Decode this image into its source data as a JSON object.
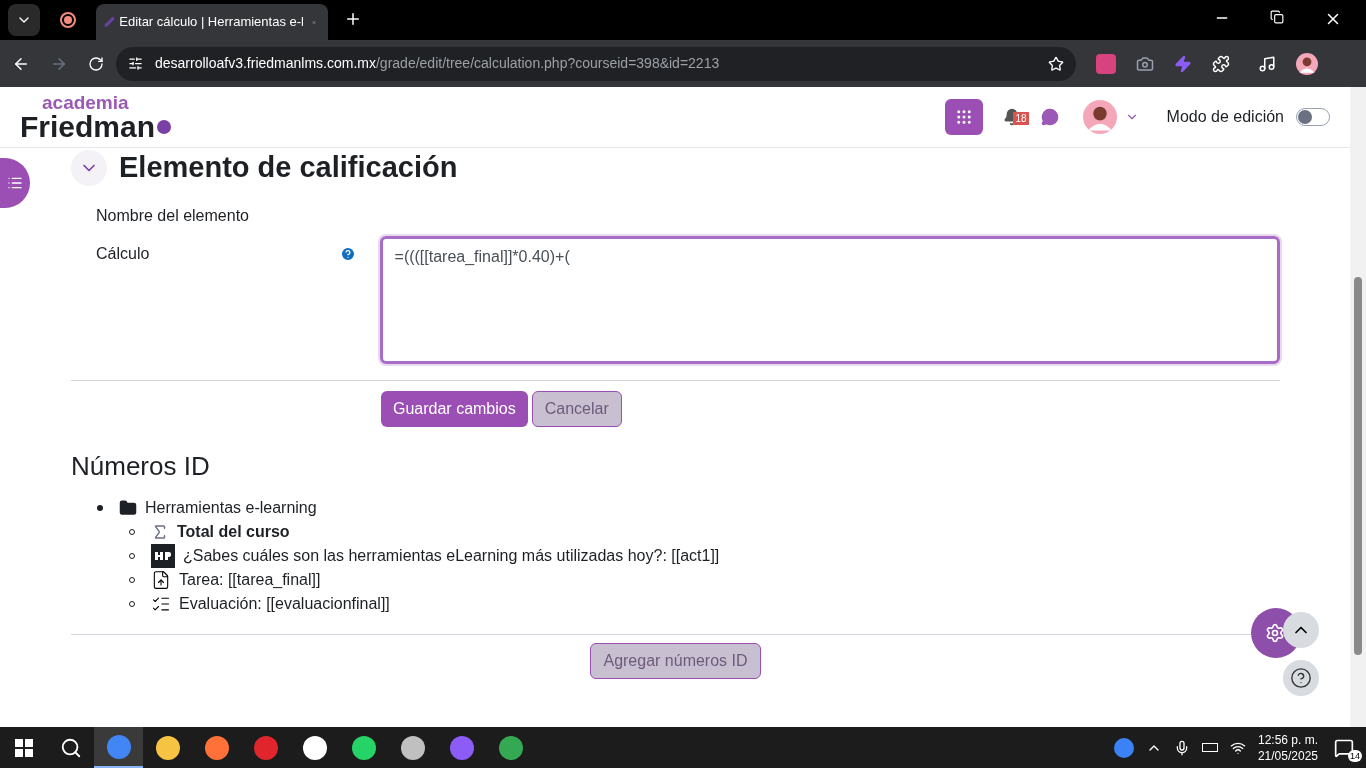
{
  "browser": {
    "tab_title": "Editar cálculo | Herramientas e-l",
    "url_host": "desarrolloafv3.friedmanlms.com.mx",
    "url_path": "/grade/edit/tree/calculation.php?courseid=398&id=2213"
  },
  "header": {
    "logo_top": "academia",
    "logo_main": "Friedman",
    "notification_count": "18",
    "edit_mode": {
      "label": "Modo de edición",
      "on": false
    }
  },
  "section": {
    "title": "Elemento de calificación",
    "expanded": true,
    "fields": [
      {
        "label": "Nombre del elemento",
        "kind": "empty"
      },
      {
        "label": "Cálculo",
        "kind": "textarea",
        "value": "=((([[tarea_final]]*0.40)+("
      }
    ]
  },
  "buttons": [
    {
      "label": "Guardar cambios",
      "kind": "primary"
    },
    {
      "label": "Cancelar",
      "kind": "secondary"
    }
  ],
  "ids": {
    "title": "Números ID",
    "items": [
      {
        "text": "Herramientas e-learning",
        "kind": "folder",
        "children": [
          {
            "text": "Total del curso",
            "kind": "total"
          },
          {
            "text": "¿Sabes cuáles son las herramientas eLearning más utilizadas hoy?: [[act1]]",
            "kind": "h5p"
          },
          {
            "text": "Tarea: [[tarea_final]]",
            "kind": "assignment"
          },
          {
            "text": "Evaluación: [[evaluacionfinal]]",
            "kind": "quiz"
          }
        ]
      }
    ]
  },
  "add_button": "Agregar números ID",
  "taskbar": {
    "time": "12:56 p. m.",
    "date": "21/05/2025",
    "notifications": "14"
  }
}
